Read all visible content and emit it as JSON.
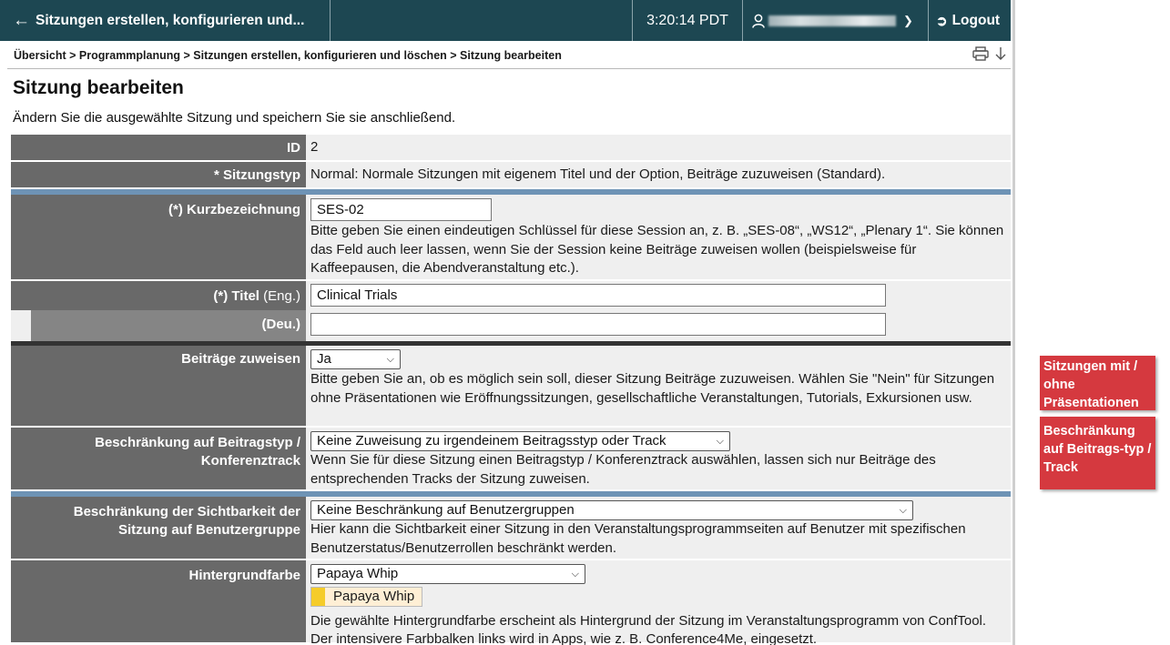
{
  "topbar": {
    "title": "Sitzungen erstellen, konfigurieren und...",
    "time": "3:20:14 PDT",
    "user_name": "Maximilian Tester",
    "logout_label": "Logout"
  },
  "breadcrumb": {
    "path": "Übersicht > Programmplanung > Sitzungen erstellen, konfigurieren und löschen > Sitzung bearbeiten"
  },
  "page": {
    "title": "Sitzung bearbeiten",
    "intro": "Ändern Sie die ausgewählte Sitzung und speichern Sie sie anschließend."
  },
  "form": {
    "id": {
      "label": "ID",
      "value": "2"
    },
    "type": {
      "label": "* Sitzungstyp",
      "value": "Normal: Normale Sitzungen mit eigenem Titel und der Option, Beiträge zuzuweisen (Standard)."
    },
    "short": {
      "label": "(*) Kurzbezeichnung",
      "value": "SES-02",
      "help": "Bitte geben Sie einen eindeutigen Schlüssel für diese Session an, z. B. „SES-08“, „WS12“, „Plenary 1“. Sie können das Feld auch leer lassen, wenn Sie der Session keine Beiträge zuweisen wollen (beispielsweise für Kaffeepausen, die Abendveranstaltung etc.)."
    },
    "title": {
      "label": "(*) Titel",
      "lang_en": "(Eng.)",
      "value_en": "Clinical Trials",
      "lang_de": "(Deu.)",
      "value_de": ""
    },
    "assign": {
      "label": "Beiträge zuweisen",
      "value": "Ja",
      "help": "Bitte geben Sie an, ob es möglich sein soll, dieser Sitzung Beiträge zuzuweisen. Wählen Sie \"Nein\" für Sitzungen ohne Präsentationen wie Eröffnungssitzungen, gesellschaftliche Veranstaltungen, Tutorials, Exkursionen usw."
    },
    "restrict_type": {
      "label_line1": "Beschränkung auf Beitragstyp /",
      "label_line2": "Konferenztrack",
      "value": "Keine Zuweisung zu irgendeinem Beitragsstyp oder Track",
      "help": "Wenn Sie für diese Sitzung einen Beitragstyp / Konferenztrack auswählen, lassen sich nur Beiträge des entsprechenden Tracks der Sitzung zuweisen."
    },
    "visibility": {
      "label_line1": "Beschränkung der Sichtbarkeit der",
      "label_line2": "Sitzung auf Benutzergruppe",
      "value": "Keine Beschränkung auf Benutzergruppen",
      "help": "Hier kann die Sichtbarkeit einer Sitzung in den Veranstaltungsprogrammseiten auf Benutzer mit spezifischen Benutzerstatus/Benutzerrollen beschränkt werden."
    },
    "bgcolor": {
      "label": "Hintergrundfarbe",
      "value": "Papaya Whip",
      "swatch_label": "Papaya Whip",
      "swatch_color": "#ffefd5",
      "help": "Die gewählte Hintergrundfarbe erscheint als Hintergrund der Sitzung im Veranstaltungsprogramm von ConfTool. Der intensivere Farbbalken links wird in Apps, wie z. B. Conference4Me, eingesetzt."
    }
  },
  "side_buttons": {
    "with_without": "Sitzungen mit / ohne Präsentationen",
    "restriction": "Beschränkung auf Beitrags-typ / Track"
  },
  "colors": {
    "topbar_bg": "#1d4752",
    "label_bg": "#696969",
    "value_bg": "#efefef",
    "separator_blue": "#6e93b5",
    "side_button_red": "#d5393f"
  }
}
